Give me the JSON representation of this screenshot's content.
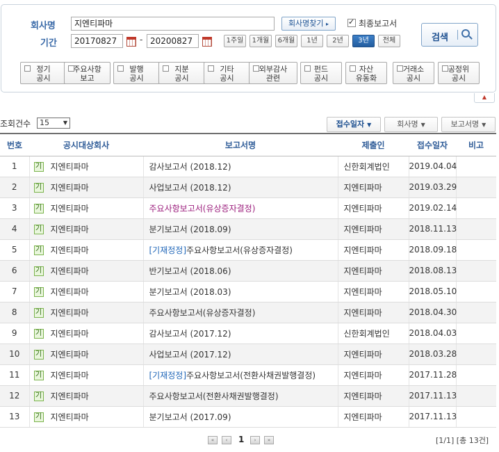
{
  "search": {
    "company_label": "회사명",
    "company_value": "지엔티파마",
    "find_company_button": "회사명찾기",
    "final_report_label": "최종보고서",
    "final_report_checked": true,
    "period_label": "기간",
    "date_from": "20170827",
    "date_sep": "-",
    "date_to": "20200827",
    "periods": [
      "1주일",
      "1개월",
      "6개월",
      "1년",
      "2년",
      "3년",
      "전체"
    ],
    "active_period": "3년",
    "search_button": "검색",
    "categories": [
      [
        "정기",
        "공시"
      ],
      [
        "주요사항",
        "보고"
      ],
      [
        "발행",
        "공시"
      ],
      [
        "지분",
        "공시"
      ],
      [
        "기타",
        "공시"
      ],
      [
        "외부감사",
        "관련"
      ],
      [
        "펀드",
        "공시"
      ],
      [
        "자산",
        "유동화"
      ],
      [
        "거래소",
        "공시"
      ],
      [
        "공정위",
        "공시"
      ]
    ]
  },
  "list_controls": {
    "count_label": "조회건수",
    "count_value": "15",
    "sort_buttons": [
      "접수일자",
      "회사명",
      "보고서명"
    ],
    "active_sort": "접수일자"
  },
  "table": {
    "headers": [
      "번호",
      "공시대상회사",
      "보고서명",
      "제출인",
      "접수일자",
      "비고"
    ],
    "badge": "기",
    "rows": [
      {
        "no": "1",
        "company": "지엔티파마",
        "prefix": "",
        "report": "감사보고서 (2018.12)",
        "style": "",
        "submitter": "신한회계법인",
        "date": "2019.04.04",
        "note": ""
      },
      {
        "no": "2",
        "company": "지엔티파마",
        "prefix": "",
        "report": "사업보고서 (2018.12)",
        "style": "",
        "submitter": "지엔티파마",
        "date": "2019.03.29",
        "note": ""
      },
      {
        "no": "3",
        "company": "지엔티파마",
        "prefix": "",
        "report": "주요사항보고서(유상증자결정)",
        "style": "pink",
        "submitter": "지엔티파마",
        "date": "2019.02.14",
        "note": ""
      },
      {
        "no": "4",
        "company": "지엔티파마",
        "prefix": "",
        "report": "분기보고서 (2018.09)",
        "style": "",
        "submitter": "지엔티파마",
        "date": "2018.11.13",
        "note": ""
      },
      {
        "no": "5",
        "company": "지엔티파마",
        "prefix": "[기재정정]",
        "report": "주요사항보고서(유상증자결정)",
        "style": "",
        "submitter": "지엔티파마",
        "date": "2018.09.18",
        "note": ""
      },
      {
        "no": "6",
        "company": "지엔티파마",
        "prefix": "",
        "report": "반기보고서 (2018.06)",
        "style": "",
        "submitter": "지엔티파마",
        "date": "2018.08.13",
        "note": ""
      },
      {
        "no": "7",
        "company": "지엔티파마",
        "prefix": "",
        "report": "분기보고서 (2018.03)",
        "style": "",
        "submitter": "지엔티파마",
        "date": "2018.05.10",
        "note": ""
      },
      {
        "no": "8",
        "company": "지엔티파마",
        "prefix": "",
        "report": "주요사항보고서(유상증자결정)",
        "style": "",
        "submitter": "지엔티파마",
        "date": "2018.04.30",
        "note": ""
      },
      {
        "no": "9",
        "company": "지엔티파마",
        "prefix": "",
        "report": "감사보고서 (2017.12)",
        "style": "",
        "submitter": "신한회계법인",
        "date": "2018.04.03",
        "note": ""
      },
      {
        "no": "10",
        "company": "지엔티파마",
        "prefix": "",
        "report": "사업보고서 (2017.12)",
        "style": "",
        "submitter": "지엔티파마",
        "date": "2018.03.28",
        "note": ""
      },
      {
        "no": "11",
        "company": "지엔티파마",
        "prefix": "[기재정정]",
        "report": "주요사항보고서(전환사채권발행결정)",
        "style": "",
        "submitter": "지엔티파마",
        "date": "2017.11.28",
        "note": ""
      },
      {
        "no": "12",
        "company": "지엔티파마",
        "prefix": "",
        "report": "주요사항보고서(전환사채권발행결정)",
        "style": "",
        "submitter": "지엔티파마",
        "date": "2017.11.13",
        "note": ""
      },
      {
        "no": "13",
        "company": "지엔티파마",
        "prefix": "",
        "report": "분기보고서 (2017.09)",
        "style": "",
        "submitter": "지엔티파마",
        "date": "2017.11.13",
        "note": ""
      }
    ]
  },
  "pagination": {
    "current_page": "1",
    "summary": "[1/1] [총 13건]"
  },
  "colors": {
    "header_text": "#2f5c98",
    "active_period_bg": "#2d6cb3",
    "correction_prefix": "#1f66b8",
    "highlighted_report": "#9b1d7c",
    "badge_green": "#7ab34c"
  }
}
